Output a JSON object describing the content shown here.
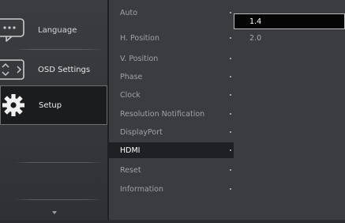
{
  "sidebar": {
    "items": [
      {
        "label": "Language",
        "icon": "language-icon"
      },
      {
        "label": "OSD Settings",
        "icon": "osd-settings-icon"
      },
      {
        "label": "Setup",
        "icon": "setup-gear-icon",
        "selected": true
      }
    ]
  },
  "menu": {
    "items": [
      "Auto",
      "H. Position",
      "V. Position",
      "Phase",
      "Clock",
      "Resolution Notification",
      "DisplayPort",
      "HDMI",
      "Reset",
      "Information"
    ],
    "active_index": 7
  },
  "options": {
    "items": [
      "1.4",
      "2.0"
    ],
    "selected_index": 0
  },
  "colors": {
    "panel": "#3a3c40",
    "selected_bg": "#1b1c1e",
    "text": "#c8c9cb",
    "option_selected_bg": "#050505"
  }
}
